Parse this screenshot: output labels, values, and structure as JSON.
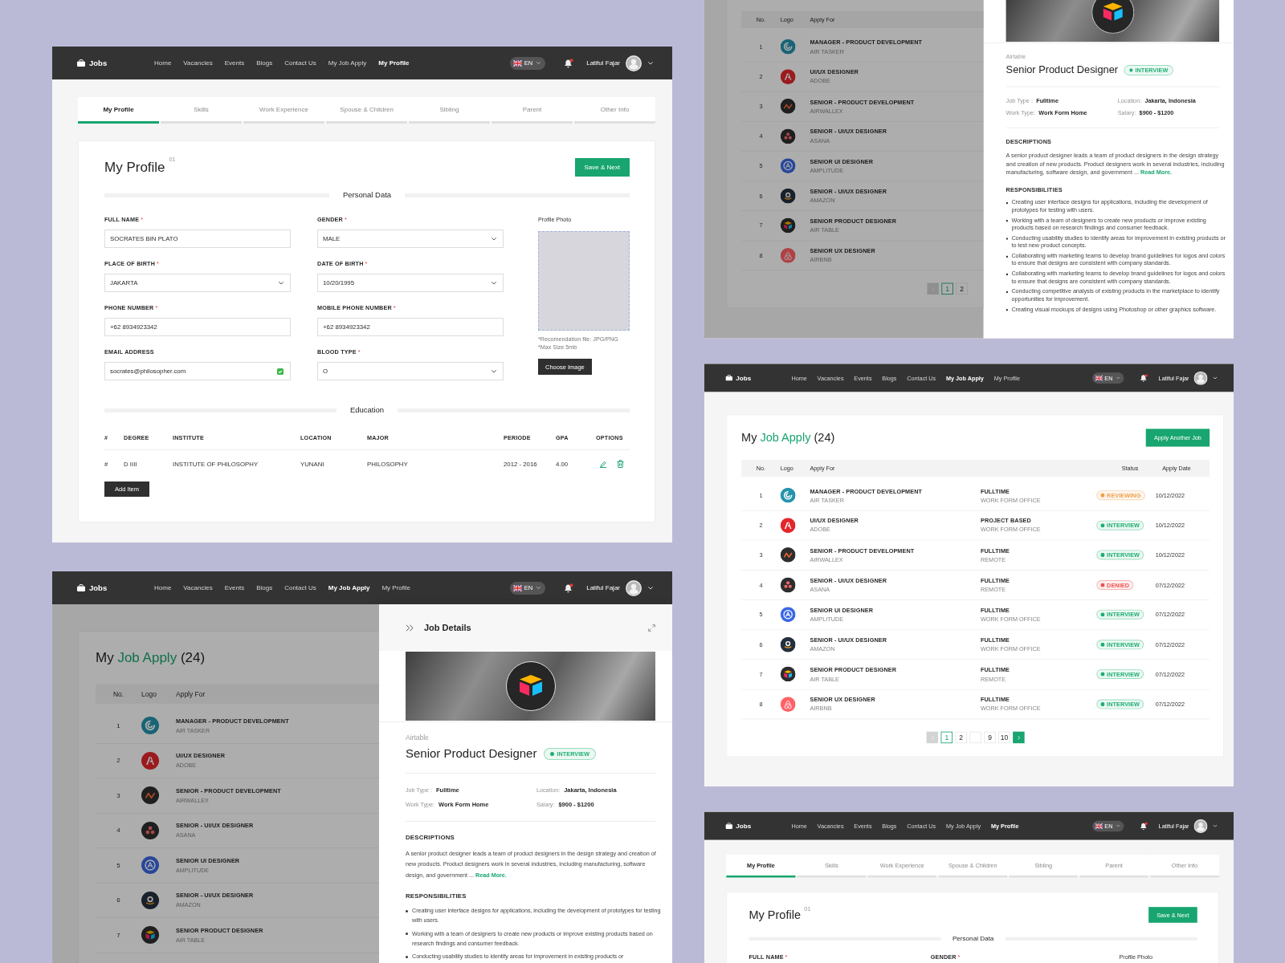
{
  "columns": [
    {
      "screens": [
        {
          "kind": "profile",
          "navbar": {
            "brand": "Jobs",
            "links": [
              {
                "label": "Home",
                "selected": false
              },
              {
                "label": "Vacancies",
                "selected": false
              },
              {
                "label": "Events",
                "selected": false
              },
              {
                "label": "Blogs",
                "selected": false
              },
              {
                "label": "Contact Us",
                "selected": false
              },
              {
                "label": "My Job Apply",
                "selected": false
              },
              {
                "label": "My Profile",
                "selected": true
              }
            ],
            "language": "EN",
            "unread": true,
            "user": "Latiful Fajar"
          },
          "tabs": [
            {
              "label": "My Profile",
              "selected": true
            },
            {
              "label": "Skills",
              "selected": false
            },
            {
              "label": "Work Experience",
              "selected": false
            },
            {
              "label": "Spouse & Children",
              "selected": false
            },
            {
              "label": "Sibling",
              "selected": false
            },
            {
              "label": "Parent",
              "selected": false
            },
            {
              "label": "Other Info",
              "selected": false
            }
          ],
          "title": "My Profile",
          "title_index": "01",
          "save_button": "Save & Next",
          "personal_section": "Personal Data",
          "fields": [
            {
              "label": "FULL NAME",
              "mark": "*",
              "kind": "text",
              "value": "SOCRATES BIN PLATO",
              "verified": false
            },
            {
              "label": "GENDER",
              "mark": "*",
              "kind": "select",
              "value": "MALE",
              "verified": false
            },
            {
              "label": "PLACE OF BIRTH",
              "mark": "*",
              "kind": "select",
              "value": "JAKARTA",
              "verified": false
            },
            {
              "label": "DATE OF BIRTH",
              "mark": "*",
              "kind": "select",
              "value": "10/20/1995",
              "verified": false
            },
            {
              "label": "PHONE NUMBER",
              "mark": "*",
              "kind": "text",
              "value": "+62 8934923342",
              "verified": false
            },
            {
              "label": "MOBILE PHONE NUMBER",
              "mark": "*",
              "kind": "text",
              "value": "+62 8934923342",
              "verified": false
            },
            {
              "label": "EMAIL ADDRESS",
              "kind": "text",
              "value": "socrates@philosopher.com",
              "verified": true
            },
            {
              "label": "BLOOD TYPE",
              "mark": "*",
              "kind": "select",
              "value": "O",
              "verified": false
            }
          ],
          "photo": {
            "label": "Profile Photo",
            "hints": [
              "*Recomendation file: JPG/PNG",
              "*Max Size 5mb"
            ],
            "button": "Choose Image"
          },
          "education": {
            "section": "Education",
            "columns": [
              "#",
              "DEGREE",
              "INSTITUTE",
              "LOCATION",
              "MAJOR",
              "PERIODE",
              "GPA",
              "OPTIONS"
            ],
            "rows": [
              {
                "cells": [
                  "#",
                  "D IIII",
                  "INSTITUTE OF PHILOSOPHY",
                  "YUNANI",
                  "PHILOSOPHY",
                  "2012 - 2016",
                  "4.00"
                ]
              }
            ],
            "add_button": "Add Item"
          }
        },
        {
          "kind": "application-details",
          "navbar": {
            "brand": "Jobs",
            "links": [
              {
                "label": "Home",
                "selected": false
              },
              {
                "label": "Vacancies",
                "selected": false
              },
              {
                "label": "Events",
                "selected": false
              },
              {
                "label": "Blogs",
                "selected": false
              },
              {
                "label": "Contact Us",
                "selected": false
              },
              {
                "label": "My Job Apply",
                "selected": true
              },
              {
                "label": "My Profile",
                "selected": false
              }
            ],
            "language": "EN",
            "unread": true,
            "user": "Latiful Fajar"
          },
          "list": {
            "title": {
              "lead": "My",
              "accent": "Job Apply",
              "count": "(24)"
            },
            "columns": [
              "No.",
              "Logo",
              "Apply For"
            ],
            "rows": [
              {
                "no": "1",
                "logo": {
                  "kind": "swirl"
                },
                "title": "MANAGER - PRODUCT DEVELOPMENT",
                "company": "AIR TASKER"
              },
              {
                "no": "2",
                "logo": {
                  "kind": "letter"
                },
                "title": "UI/UX DESIGNER",
                "company": "ADOBE"
              },
              {
                "no": "3",
                "logo": {
                  "kind": "zigzag"
                },
                "title": "SENIOR - PRODUCT DEVELOPMENT",
                "company": "AIRWALLEX"
              },
              {
                "no": "4",
                "logo": {
                  "kind": "dots"
                },
                "title": "SENIOR - UI/UX DESIGNER",
                "company": "ASANA"
              },
              {
                "no": "5",
                "logo": {
                  "kind": "ring"
                },
                "title": "SENIOR UI DESIGNER",
                "company": "AMPLITUDE"
              },
              {
                "no": "6",
                "logo": {
                  "kind": "smile"
                },
                "title": "SENIOR - UI/UX DESIGNER",
                "company": "AMAZON"
              },
              {
                "no": "7",
                "logo": {
                  "kind": "cube"
                },
                "title": "SENIOR PRODUCT DESIGNER",
                "company": "AIR TABLE"
              }
            ]
          },
          "details": {
            "header": "Job Details",
            "company": "Airtable",
            "role": "Senior Product Designer",
            "status": {
              "label": "INTERVIEW",
              "color": "#1fae74"
            },
            "meta": [
              {
                "label": "Job Type :",
                "value": "Fulltime"
              },
              {
                "label": "Location:",
                "value": "Jakarta, Indonesia"
              },
              {
                "label": "Work Type:",
                "value": "Work Form Home"
              },
              {
                "label": "Salary:",
                "value": "$900 - $1200"
              }
            ],
            "descriptions": {
              "heading": "DESCRIPTIONS",
              "text": "A senior product designer leads a team of product designers in the design strategy and creation of new products. Product designers work in several industries, including manufacturing, software design, and government ...",
              "link": "Read More."
            },
            "responsibilities": {
              "heading": "RESPONSIBILITIES",
              "items": [
                "Creating user interface designs for applications, including the development of prototypes for testing with users.",
                "Working with a team of designers to create new products or improve existing products based on research findings and consumer feedback.",
                "Conducting usability studies to identify areas for improvement in existing products or"
              ]
            }
          }
        }
      ]
    },
    {
      "screens": [
        {
          "kind": "application-details",
          "list": {
            "columns": [
              "No.",
              "Logo",
              "Apply For"
            ],
            "rows": [
              {
                "no": "1",
                "logo": {
                  "kind": "swirl"
                },
                "title": "MANAGER - PRODUCT DEVELOPMENT",
                "company": "AIR TASKER"
              },
              {
                "no": "2",
                "logo": {
                  "kind": "letter"
                },
                "title": "UI/UX DESIGNER",
                "company": "ADOBE"
              },
              {
                "no": "3",
                "logo": {
                  "kind": "zigzag"
                },
                "title": "SENIOR - PRODUCT DEVELOPMENT",
                "company": "AIRWALLEX"
              },
              {
                "no": "4",
                "logo": {
                  "kind": "dots"
                },
                "title": "SENIOR - UI/UX DESIGNER",
                "company": "ASANA"
              },
              {
                "no": "5",
                "logo": {
                  "kind": "ring"
                },
                "title": "SENIOR UI DESIGNER",
                "company": "AMPLITUDE"
              },
              {
                "no": "6",
                "logo": {
                  "kind": "smile"
                },
                "title": "SENIOR - UI/UX DESIGNER",
                "company": "AMAZON"
              },
              {
                "no": "7",
                "logo": {
                  "kind": "cube"
                },
                "title": "SENIOR PRODUCT DESIGNER",
                "company": "AIR TABLE"
              },
              {
                "no": "8",
                "logo": {
                  "kind": "loop"
                },
                "title": "SENIOR UX DESIGNER",
                "company": "AIRBNB"
              }
            ],
            "pagination": [
              {
                "kind": "prev",
                "disabled": true
              },
              {
                "kind": "page",
                "label": "1",
                "selected": true
              },
              {
                "kind": "page",
                "label": "2",
                "selected": false
              }
            ]
          },
          "details": {
            "company": "Airtable",
            "role": "Senior Product Designer",
            "status": {
              "label": "INTERVIEW",
              "color": "#1fae74"
            },
            "meta": [
              {
                "label": "Job Type :",
                "value": "Fulltime"
              },
              {
                "label": "Location:",
                "value": "Jakarta, Indonesia"
              },
              {
                "label": "Work Type:",
                "value": "Work Form Home"
              },
              {
                "label": "Salary:",
                "value": "$900 - $1200"
              }
            ],
            "descriptions": {
              "heading": "DESCRIPTIONS",
              "text": "A senior product designer leads a team of product designers in the design strategy and creation of new products. Product designers work in several industries, including manufacturing, software design, and government ...",
              "link": "Read More."
            },
            "responsibilities": {
              "heading": "RESPONSIBILITIES",
              "items": [
                "Creating user interface designs for applications, including the development of prototypes for testing with users.",
                "Working with a team of designers to create new products or improve existing products based on research findings and consumer feedback.",
                "Conducting usability studies to identify areas for improvement in existing products or to test new product concepts.",
                "Collaborating with marketing teams to develop brand guidelines for logos and colors to ensure that designs are consistent with company standards.",
                "Collaborating with marketing teams to develop brand guidelines for logos and colors to ensure that designs are consistent with company standards.",
                "Conducting competitive analysis of existing products in the marketplace to identify opportunities for improvement.",
                "Creating visual mockups of designs using Photoshop or other graphics software."
              ]
            }
          }
        },
        {
          "kind": "applications",
          "navbar": {
            "brand": "Jobs",
            "links": [
              {
                "label": "Home",
                "selected": false
              },
              {
                "label": "Vacancies",
                "selected": false
              },
              {
                "label": "Events",
                "selected": false
              },
              {
                "label": "Blogs",
                "selected": false
              },
              {
                "label": "Contact Us",
                "selected": false
              },
              {
                "label": "My Job Apply",
                "selected": true
              },
              {
                "label": "My Profile",
                "selected": false
              }
            ],
            "language": "EN",
            "unread": true,
            "user": "Latiful Fajar"
          },
          "list": {
            "title": {
              "lead": "My",
              "accent": "Job Apply",
              "count": "(24)"
            },
            "action_button": "Apply Another Job",
            "columns": [
              "No.",
              "Logo",
              "Apply For",
              "Status",
              "Apply Date"
            ],
            "rows": [
              {
                "no": "1",
                "logo": {
                  "kind": "swirl"
                },
                "title": "MANAGER - PRODUCT DEVELOPMENT",
                "company": "AIR TASKER",
                "type": "FULLTIME",
                "place": "WORK FORM OFFICE",
                "status": {
                  "label": "REVIEWING",
                  "color": "#f0a04b"
                },
                "date": "10/12/2022"
              },
              {
                "no": "2",
                "logo": {
                  "kind": "letter"
                },
                "title": "UI/UX DESIGNER",
                "company": "ADOBE",
                "type": "PROJECT BASED",
                "place": "WORK FORM OFFICE",
                "status": {
                  "label": "INTERVIEW",
                  "color": "#1fae74"
                },
                "date": "10/12/2022"
              },
              {
                "no": "3",
                "logo": {
                  "kind": "zigzag"
                },
                "title": "SENIOR - PRODUCT DEVELOPMENT",
                "company": "AIRWALLEX",
                "type": "FULLTIME",
                "place": "REMOTE",
                "status": {
                  "label": "INTERVIEW",
                  "color": "#1fae74"
                },
                "date": "10/12/2022"
              },
              {
                "no": "4",
                "logo": {
                  "kind": "dots"
                },
                "title": "SENIOR - UI/UX DESIGNER",
                "company": "ASANA",
                "type": "FULLTIME",
                "place": "REMOTE",
                "status": {
                  "label": "DENIED",
                  "color": "#ef5350"
                },
                "date": "07/12/2022"
              },
              {
                "no": "5",
                "logo": {
                  "kind": "ring"
                },
                "title": "SENIOR UI DESIGNER",
                "company": "AMPLITUDE",
                "type": "FULLTIME",
                "place": "WORK FORM OFFICE",
                "status": {
                  "label": "INTERVIEW",
                  "color": "#1fae74"
                },
                "date": "07/12/2022"
              },
              {
                "no": "6",
                "logo": {
                  "kind": "smile"
                },
                "title": "SENIOR - UI/UX DESIGNER",
                "company": "AMAZON",
                "type": "FULLTIME",
                "place": "WORK FORM OFFICE",
                "status": {
                  "label": "INTERVIEW",
                  "color": "#1fae74"
                },
                "date": "07/12/2022"
              },
              {
                "no": "7",
                "logo": {
                  "kind": "cube"
                },
                "title": "SENIOR PRODUCT DESIGNER",
                "company": "AIR TABLE",
                "type": "FULLTIME",
                "place": "REMOTE",
                "status": {
                  "label": "INTERVIEW",
                  "color": "#1fae74"
                },
                "date": "07/12/2022"
              },
              {
                "no": "8",
                "logo": {
                  "kind": "loop"
                },
                "title": "SENIOR UX DESIGNER",
                "company": "AIRBNB",
                "type": "FULLTIME",
                "place": "WORK FORM OFFICE",
                "status": {
                  "label": "INTERVIEW",
                  "color": "#1fae74"
                },
                "date": "07/12/2022"
              }
            ],
            "pagination": [
              {
                "kind": "prev",
                "disabled": true
              },
              {
                "kind": "page",
                "label": "1",
                "selected": true
              },
              {
                "kind": "page",
                "label": "2",
                "selected": false
              },
              {
                "kind": "gap"
              },
              {
                "kind": "page",
                "label": "9",
                "selected": false
              },
              {
                "kind": "page",
                "label": "10",
                "selected": false
              },
              {
                "kind": "next",
                "disabled": false
              }
            ]
          }
        },
        {
          "kind": "profile",
          "navbar": {
            "brand": "Jobs",
            "links": [
              {
                "label": "Home",
                "selected": false
              },
              {
                "label": "Vacancies",
                "selected": false
              },
              {
                "label": "Events",
                "selected": false
              },
              {
                "label": "Blogs",
                "selected": false
              },
              {
                "label": "Contact Us",
                "selected": false
              },
              {
                "label": "My Job Apply",
                "selected": false
              },
              {
                "label": "My Profile",
                "selected": true
              }
            ],
            "language": "EN",
            "unread": true,
            "user": "Latiful Fajar"
          },
          "tabs": [
            {
              "label": "My Profile",
              "selected": true
            },
            {
              "label": "Skills",
              "selected": false
            },
            {
              "label": "Work Experience",
              "selected": false
            },
            {
              "label": "Spouse & Children",
              "selected": false
            },
            {
              "label": "Sibling",
              "selected": false
            },
            {
              "label": "Parent",
              "selected": false
            },
            {
              "label": "Other Info",
              "selected": false
            }
          ],
          "title": "My Profile",
          "title_index": "01",
          "save_button": "Save & Next",
          "personal_section": "Personal Data",
          "fields": [
            {
              "label": "FULL NAME",
              "mark": "*"
            },
            {
              "label": "GENDER",
              "mark": "*"
            }
          ],
          "photo": {
            "label": "Profile Photo"
          }
        }
      ]
    }
  ]
}
